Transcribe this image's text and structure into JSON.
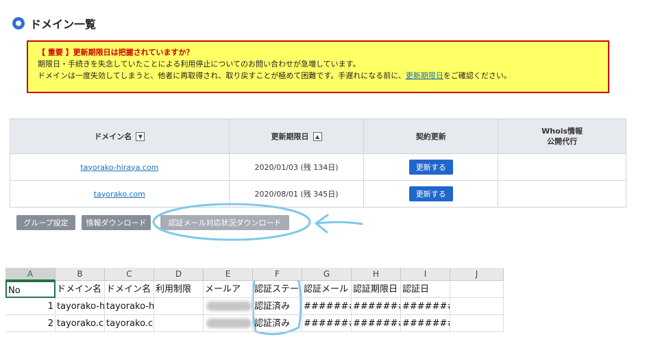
{
  "heading": {
    "title": "ドメイン一覧"
  },
  "warning": {
    "title": "【 重要 】更新期限日は把握されていますか？",
    "line1": "期限日・手続きを失念していたことによる利用停止についてのお問い合わせが急増しています。",
    "line2_before": "ドメインは一度失効してしまうと、他者に再取得され、取り戻すことが極めて困難です。手遅れになる前に、",
    "line2_link": "更新期限日",
    "line2_after": "をご確認ください。"
  },
  "table": {
    "headers": {
      "domain": "ドメイン名",
      "domain_sort": "▼",
      "expiry": "更新期限日",
      "expiry_sort": "▲",
      "renewal": "契約更新",
      "whois_line1": "Whois情報",
      "whois_line2": "公開代行"
    },
    "rows": [
      {
        "domain": "tayorako-hiraya.com",
        "expiry": "2020/01/03 (残 134日)",
        "renew_label": "更新する"
      },
      {
        "domain": "tayorako.com",
        "expiry": "2020/08/01 (残 345日)",
        "renew_label": "更新する"
      }
    ]
  },
  "actions": {
    "group": "グループ設定",
    "info_download": "情報ダウンロード",
    "cert_download": "認証メール対応状況ダウンロード"
  },
  "spreadsheet": {
    "columns": [
      "A",
      "B",
      "C",
      "D",
      "E",
      "F",
      "G",
      "H",
      "I",
      "J"
    ],
    "header_row": [
      "No",
      "ドメイン名",
      "ドメイン名",
      "利用制限",
      "メールア",
      "認証ステー",
      "認証メール",
      "認証期限日",
      "認証日",
      ""
    ],
    "rows": [
      [
        "1",
        "tayorako-hiraya.com",
        "tayorako-hiraya.com",
        "",
        "",
        "認証済み",
        "#######",
        "#######",
        "#######",
        ""
      ],
      [
        "2",
        "tayorako.com",
        "tayorako.com",
        "",
        "",
        "認証済み",
        "#######",
        "#######",
        "#######",
        ""
      ]
    ]
  },
  "colors": {
    "accent": "#2266cc",
    "warning_bg": "#ffff66",
    "warning_border": "#cc0000",
    "annotation": "#7ec8ea"
  }
}
